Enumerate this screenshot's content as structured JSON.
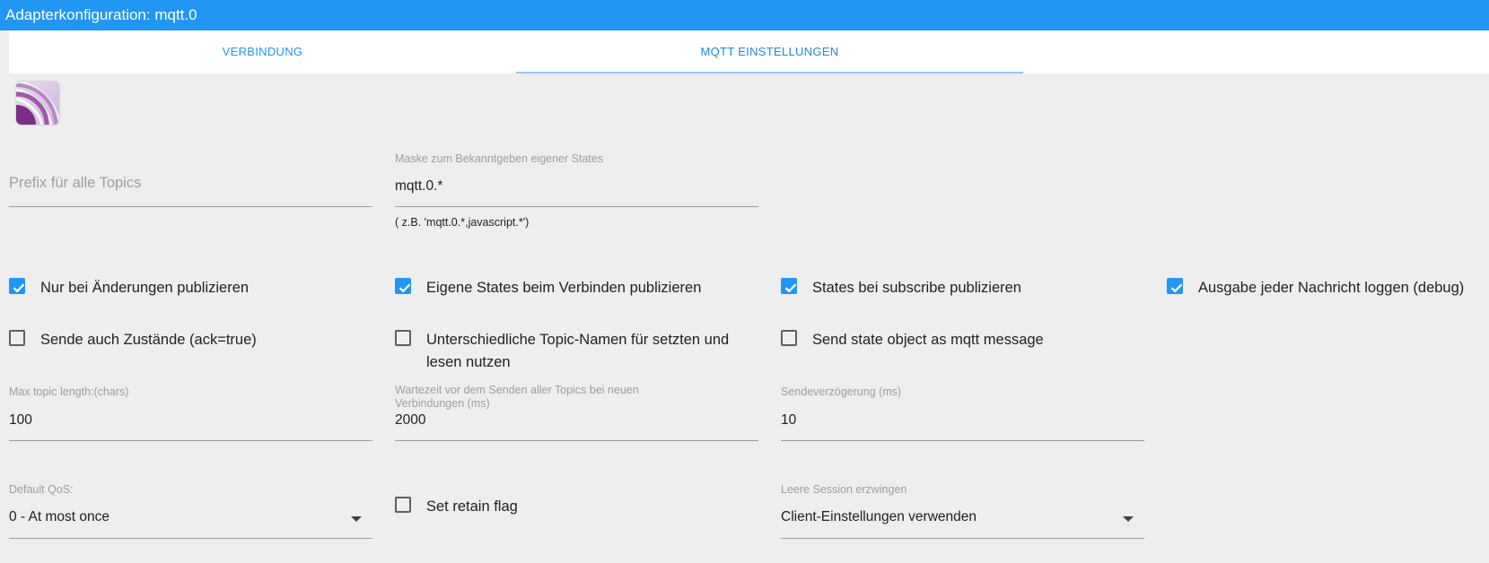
{
  "window": {
    "title": "Adapterkonfiguration: mqtt.0"
  },
  "tabs": [
    {
      "label": "VERBINDUNG",
      "active": false
    },
    {
      "label": "MQTT EINSTELLUNGEN",
      "active": true
    }
  ],
  "logo": {
    "icon": "mqtt-adapter-icon"
  },
  "prefix": {
    "placeholder": "Prefix für alle Topics",
    "value": ""
  },
  "mask": {
    "label": "Maske zum Bekanntgeben eigener States",
    "value": "mqtt.0.*",
    "help": "( z.B. 'mqtt.0.*,javascript.*')"
  },
  "checkboxes": {
    "only_changes": {
      "label": "Nur bei Änderungen publizieren",
      "checked": true
    },
    "own_states_connect": {
      "label": "Eigene States beim Verbinden publizieren",
      "checked": true
    },
    "states_subscribe": {
      "label": "States bei subscribe publizieren",
      "checked": true
    },
    "debug_log": {
      "label": "Ausgabe jeder Nachricht loggen (debug)",
      "checked": true
    },
    "send_ack": {
      "label": "Sende auch Zustände (ack=true)",
      "checked": false
    },
    "diff_topics": {
      "label": "Unterschiedliche Topic-Namen für setzten und lesen nutzen",
      "checked": false
    },
    "state_object": {
      "label": "Send state object as mqtt message",
      "checked": false
    },
    "retain": {
      "label": "Set retain flag",
      "checked": false
    }
  },
  "max_topic": {
    "label": "Max topic length:(chars)",
    "value": "100"
  },
  "wait_time": {
    "label": "Wartezeit vor dem Senden aller Topics bei neuen Verbindungen (ms)",
    "value": "2000"
  },
  "send_delay": {
    "label": "Sendeverzögerung (ms)",
    "value": "10"
  },
  "qos": {
    "label": "Default QoS:",
    "value": "0 - At most once"
  },
  "clean_session": {
    "label": "Leere Session erzwingen",
    "value": "Client-Einstellungen verwenden"
  },
  "colors": {
    "primary": "#2196f3",
    "background": "#eeeeee"
  }
}
